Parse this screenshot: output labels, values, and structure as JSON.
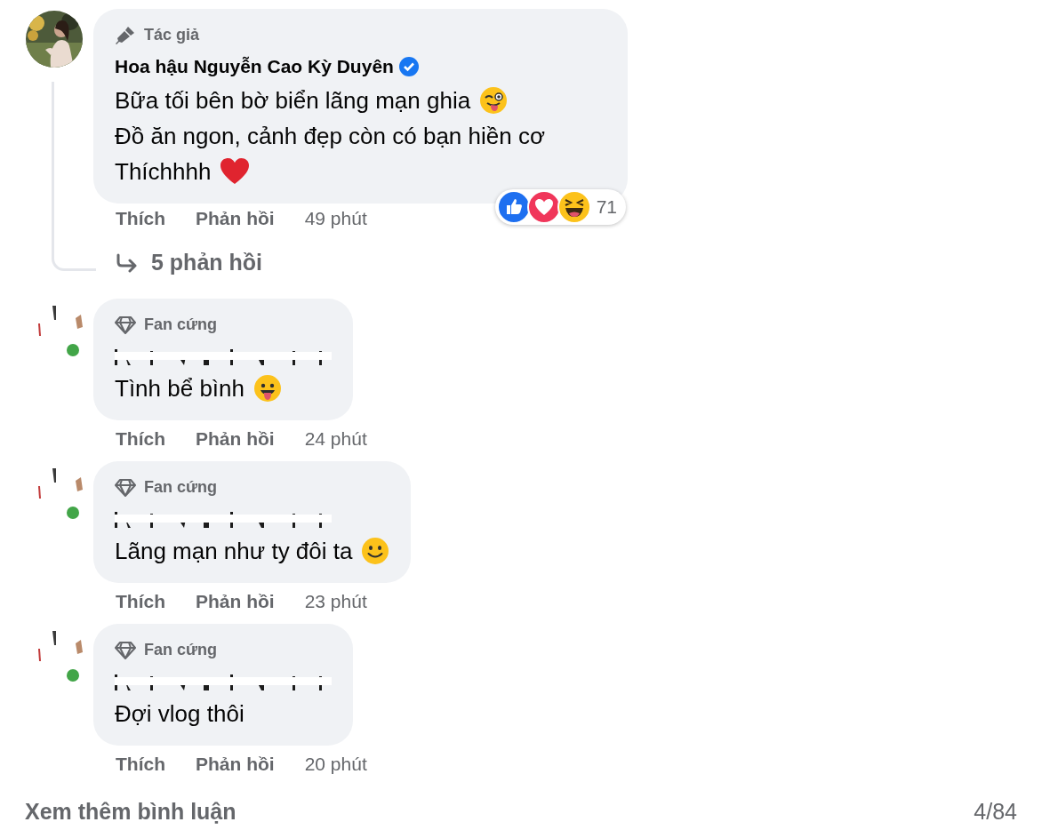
{
  "comments": [
    {
      "badge": {
        "kind": "author",
        "label": "Tác giả"
      },
      "author": "Hoa hậu Nguyễn Cao Kỳ Duyên",
      "verified": true,
      "lines": [
        {
          "text": "Bữa tối bên bờ biển lãng mạn ghia",
          "kind": "wink"
        },
        {
          "text": "Đồ ăn ngon, cảnh đẹp còn có bạn hiền cơ",
          "kind": "plain"
        },
        {
          "text": "Thíchhhh",
          "kind": "heart"
        }
      ],
      "reactions": {
        "items": [
          {
            "kind": "like"
          },
          {
            "kind": "love"
          },
          {
            "kind": "haha"
          }
        ],
        "count": "71"
      },
      "actions": [
        "Thích",
        "Phản hồi"
      ],
      "time": "49 phút",
      "replies": "5 phản hồi"
    },
    {
      "badge": {
        "kind": "fan",
        "label": "Fan cứng"
      },
      "online": true,
      "lines": [
        {
          "text": "Tình bể bình",
          "kind": "tongue"
        }
      ],
      "actions": [
        "Thích",
        "Phản hồi"
      ],
      "time": "24 phút"
    },
    {
      "badge": {
        "kind": "fan",
        "label": "Fan cứng"
      },
      "online": true,
      "lines": [
        {
          "text": "Lãng mạn như ty đôi ta",
          "kind": "smile"
        }
      ],
      "actions": [
        "Thích",
        "Phản hồi"
      ],
      "time": "23 phút"
    },
    {
      "badge": {
        "kind": "fan",
        "label": "Fan cứng"
      },
      "online": true,
      "lines": [
        {
          "text": "Đợi vlog thôi",
          "kind": "plain"
        }
      ],
      "actions": [
        "Thích",
        "Phản hồi"
      ],
      "time": "20 phút"
    }
  ],
  "footer": {
    "more": "Xem thêm bình luận",
    "count": "4/84"
  }
}
